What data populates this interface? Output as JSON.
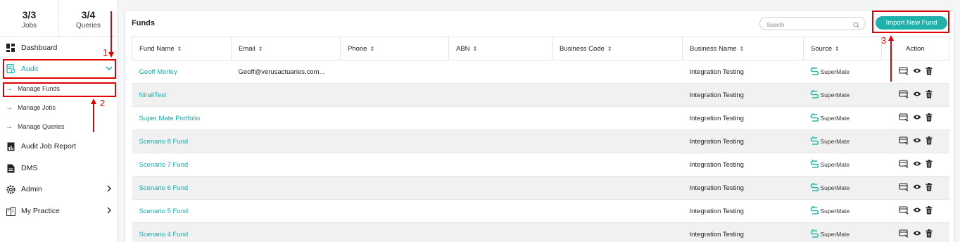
{
  "sidebar": {
    "stats": [
      {
        "value": "3/3",
        "label": "Jobs"
      },
      {
        "value": "3/4",
        "label": "Queries"
      }
    ],
    "items": [
      {
        "label": "Dashboard",
        "icon": "dashboard-icon"
      },
      {
        "label": "Audit",
        "icon": "audit-icon",
        "active": true,
        "chevron": "down"
      },
      {
        "label": "Audit Job Report",
        "icon": "report-icon"
      },
      {
        "label": "DMS",
        "icon": "document-icon"
      },
      {
        "label": "Admin",
        "icon": "gear-icon",
        "chevron": "right"
      },
      {
        "label": "My Practice",
        "icon": "practice-icon",
        "chevron": "right"
      }
    ],
    "subitems": [
      {
        "label": "Manage Funds"
      },
      {
        "label": "Manage Jobs"
      },
      {
        "label": "Manage Queries"
      }
    ]
  },
  "annotations": {
    "step1": "1",
    "step2": "2",
    "step3": "3",
    "color": "#e00000"
  },
  "main": {
    "title": "Funds",
    "search_placeholder": "Search",
    "import_button": "Import New Fund",
    "accent_color": "#20b2aa",
    "columns": [
      "Fund Name",
      "Email",
      "Phone",
      "ABN",
      "Business Code",
      "Business Name",
      "Source",
      "Action"
    ],
    "rows": [
      {
        "fund": "Geoff Morley",
        "email": "Geoff@verusactuaries.com...",
        "phone": "",
        "abn": "",
        "code": "",
        "business": "Integration Testing",
        "source": "SuperMate"
      },
      {
        "fund": "NiraliTest",
        "email": "",
        "phone": "",
        "abn": "",
        "code": "",
        "business": "Integration Testing",
        "source": "SuperMate"
      },
      {
        "fund": "Super Mate Portfolio",
        "email": "",
        "phone": "",
        "abn": "",
        "code": "",
        "business": "Integration Testing",
        "source": "SuperMate"
      },
      {
        "fund": "Scenario 8 Fund",
        "email": "",
        "phone": "",
        "abn": "",
        "code": "",
        "business": "Integration Testing",
        "source": "SuperMate"
      },
      {
        "fund": "Scenario 7 Fund",
        "email": "",
        "phone": "",
        "abn": "",
        "code": "",
        "business": "Integration Testing",
        "source": "SuperMate"
      },
      {
        "fund": "Scenario 6 Fund",
        "email": "",
        "phone": "",
        "abn": "",
        "code": "",
        "business": "Integration Testing",
        "source": "SuperMate"
      },
      {
        "fund": "Scenario 5 Fund",
        "email": "",
        "phone": "",
        "abn": "",
        "code": "",
        "business": "Integration Testing",
        "source": "SuperMate"
      },
      {
        "fund": "Scenario 4 Fund",
        "email": "",
        "phone": "",
        "abn": "",
        "code": "",
        "business": "Integration Testing",
        "source": "SuperMate"
      }
    ]
  }
}
